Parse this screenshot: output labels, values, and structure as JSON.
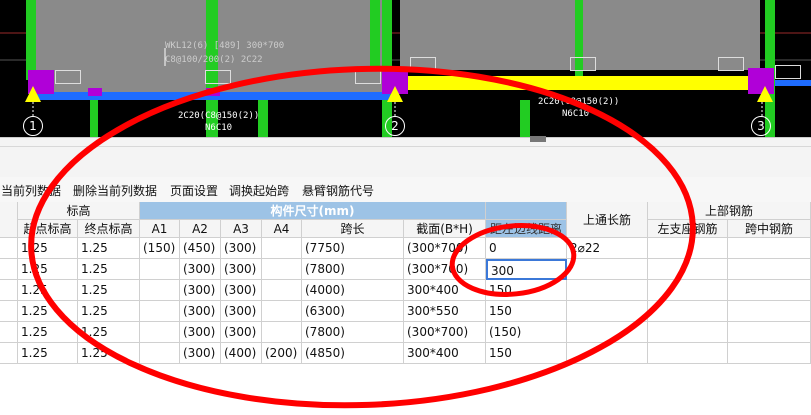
{
  "cad": {
    "top_label_1": "WKL12(6) [489] 300*700",
    "top_label_2": "C8@100/200(2) 2C22",
    "bottom_label_1": "2C20(C8@150(2))",
    "bottom_label_1b": "N6C10",
    "bottom_label_2": "2C20(C8@150(2))",
    "bottom_label_2b": "N6C10",
    "axis_1": "1",
    "axis_2": "2",
    "axis_3": "3",
    "colors": {
      "beam_blue": "#1e6cff",
      "beam_yellow": "#ffff00",
      "column_green": "#22cc22",
      "support_magenta": "#b000d8"
    }
  },
  "toolbar": {
    "items": [
      "当前列数据",
      "删除当前列数据",
      "页面设置",
      "调换起始跨",
      "悬臂钢筋代号"
    ]
  },
  "table": {
    "group_elevation": "标高",
    "group_dimensions": "构件尺寸(mm)",
    "group_top_rebar": "上部钢筋",
    "header_top_long": "上通长筋",
    "header_left_support": "左支座钢筋",
    "header_mid_span": "跨中钢筋",
    "col_start_elev": "起点标高",
    "col_end_elev": "终点标高",
    "col_a1": "A1",
    "col_a2": "A2",
    "col_a3": "A3",
    "col_a4": "A4",
    "col_span": "跨长",
    "col_section": "截面(B*H)",
    "col_offset": "距左边线距离",
    "rows": [
      {
        "start": "1.25",
        "end": "1.25",
        "a1": "(150)",
        "a2": "(450)",
        "a3": "(300)",
        "a4": "",
        "span": "(7750)",
        "section": "(300*700)",
        "offset": "0",
        "top_long": "2⌀22"
      },
      {
        "start": "1.25",
        "end": "1.25",
        "a1": "",
        "a2": "(300)",
        "a3": "(300)",
        "a4": "",
        "span": "(7800)",
        "section": "(300*700)",
        "offset": "300",
        "top_long": ""
      },
      {
        "start": "1.25",
        "end": "1.25",
        "a1": "",
        "a2": "(300)",
        "a3": "(300)",
        "a4": "",
        "span": "(4000)",
        "section": "300*400",
        "offset": "150",
        "top_long": ""
      },
      {
        "start": "1.25",
        "end": "1.25",
        "a1": "",
        "a2": "(300)",
        "a3": "(300)",
        "a4": "",
        "span": "(6300)",
        "section": "300*550",
        "offset": "150",
        "top_long": ""
      },
      {
        "start": "1.25",
        "end": "1.25",
        "a1": "",
        "a2": "(300)",
        "a3": "(300)",
        "a4": "",
        "span": "(7800)",
        "section": "(300*700)",
        "offset": "(150)",
        "top_long": ""
      },
      {
        "start": "1.25",
        "end": "1.25",
        "a1": "",
        "a2": "(300)",
        "a3": "(400)",
        "a4": "(200)",
        "span": "(4850)",
        "section": "300*400",
        "offset": "150",
        "top_long": ""
      }
    ]
  },
  "annotation": {
    "color": "#ff0000"
  }
}
